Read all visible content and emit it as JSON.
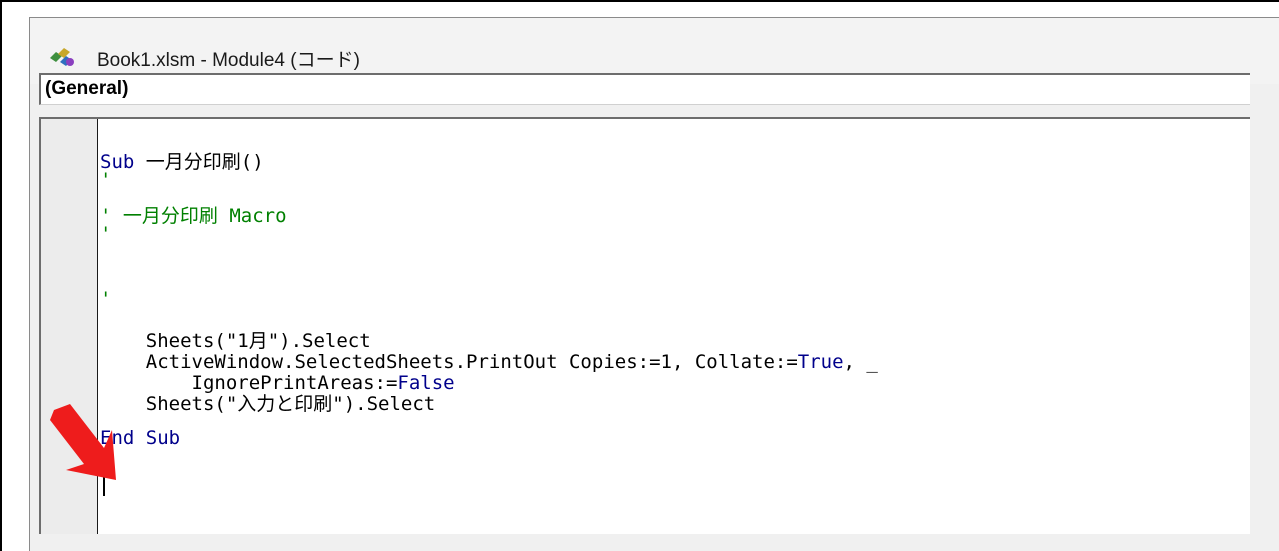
{
  "window": {
    "title": "Book1.xlsm - Module4 (コード)",
    "icon": "vba-module-icon"
  },
  "procedure_dropdown": {
    "value": "(General)"
  },
  "code": {
    "line1": {
      "kw": "Sub",
      "text": " 一月分印刷()"
    },
    "line2": {
      "text": "'"
    },
    "line3": {
      "text": "' 一月分印刷 Macro"
    },
    "line4": {
      "text": "'"
    },
    "line5": {
      "text": "'"
    },
    "line6": {
      "text": "    Sheets(\"1月\").Select"
    },
    "line7": {
      "text_a": "    ActiveWindow.SelectedSheets.PrintOut Copies:=1, Collate:=",
      "kw": "True",
      "text_b": ", _"
    },
    "line8": {
      "text_a": "        IgnorePrintAreas:=",
      "kw": "False"
    },
    "line9": {
      "text": "    Sheets(\"入力と印刷\").Select"
    },
    "line10": {
      "kw": "End Sub"
    }
  },
  "annotation": {
    "arrow_color": "#ee1c1c"
  }
}
